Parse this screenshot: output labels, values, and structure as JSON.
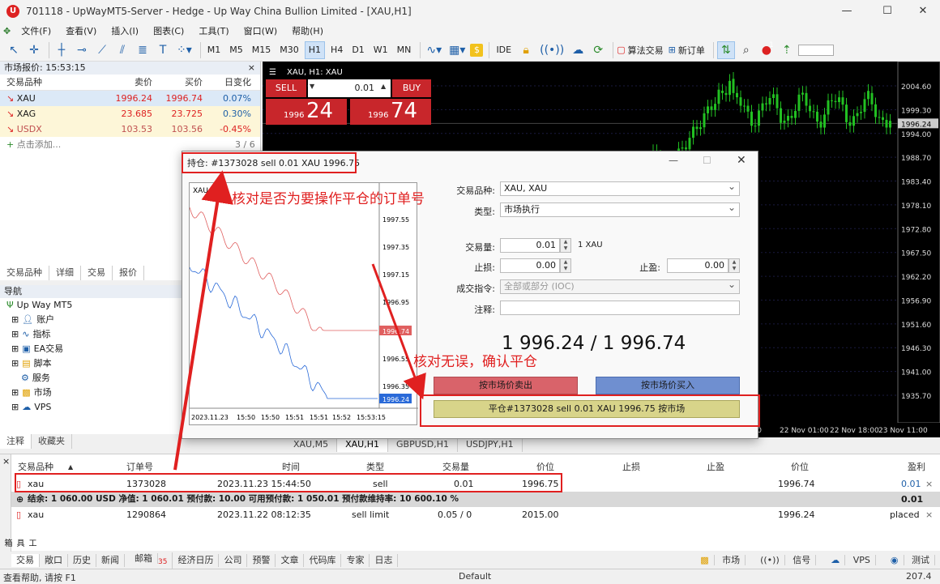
{
  "titlebar": {
    "logo": "U",
    "title": "701118 - UpWayMT5-Server - Hedge - Up Way China Bullion Limited - [XAU,H1]",
    "min": "—",
    "max": "☐",
    "close": "✕"
  },
  "menu": [
    "文件(F)",
    "查看(V)",
    "插入(I)",
    "图表(C)",
    "工具(T)",
    "窗口(W)",
    "帮助(H)"
  ],
  "toolbar": {
    "timeframes": [
      "M1",
      "M5",
      "M15",
      "M30",
      "H1",
      "H4",
      "D1",
      "W1",
      "MN"
    ],
    "active_tf": "H1",
    "ide": "IDE",
    "algo": "算法交易",
    "new_order": "新订单",
    "badge": "1"
  },
  "market_watch": {
    "title": "市场报价: 15:53:15",
    "headers": [
      "交易品种",
      "卖价",
      "买价",
      "日变化"
    ],
    "rows": [
      {
        "sym": "XAU",
        "bid": "1996.24",
        "ask": "1996.74",
        "chg": "0.07%"
      },
      {
        "sym": "XAG",
        "bid": "23.685",
        "ask": "23.725",
        "chg": "0.30%"
      },
      {
        "sym": "USDX",
        "bid": "103.53",
        "ask": "103.56",
        "chg": "-0.45%"
      }
    ],
    "add": "点击添加...",
    "count": "3 / 6",
    "tabs": [
      "交易品种",
      "详细",
      "交易",
      "报价"
    ]
  },
  "navigator": {
    "title": "导航",
    "root": "Up Way MT5",
    "items": [
      "账户",
      "指标",
      "EA交易",
      "脚本",
      "服务",
      "市场",
      "VPS"
    ],
    "tabs": [
      "注释",
      "收藏夹"
    ]
  },
  "chart": {
    "header": "XAU, H1: XAU",
    "sell": "SELL",
    "buy": "BUY",
    "lot": "0.01",
    "sell_big": "24",
    "sell_small": "1996",
    "buy_big": "74",
    "buy_small": "1996",
    "price_labels": [
      "2004.60",
      "1999.30",
      "1994.00",
      "1988.70",
      "1983.40",
      "1978.10",
      "1972.80",
      "1967.50",
      "1962.20",
      "1956.90",
      "1951.60",
      "1946.30",
      "1941.00",
      "1935.70"
    ],
    "current": "1996.24",
    "time_labels": [
      "09:00",
      "22 Nov 01:00",
      "22 Nov 18:00",
      "23 Nov 11:00"
    ],
    "tabs": [
      "XAU,M5",
      "XAU,H1",
      "GBPUSD,H1",
      "USDJPY,H1"
    ],
    "active_tab": "XAU,H1"
  },
  "dialog": {
    "title": "持仓: #1373028 sell 0.01 XAU 1996.75",
    "mini_symbol": "XAU",
    "mini_prices": [
      "1997.55",
      "1997.35",
      "1997.15",
      "1996.95",
      "1996.74",
      "1996.55",
      "1996.35",
      "1996.24"
    ],
    "mini_times": [
      "2023.11.23",
      "15:50",
      "15:50",
      "15:51",
      "15:51",
      "15:52",
      "15:53:15"
    ],
    "symbol_label": "交易品种:",
    "symbol": "XAU, XAU",
    "type_label": "类型:",
    "type": "市场执行",
    "volume_label": "交易量:",
    "volume": "0.01",
    "volume_unit": "1 XAU",
    "sl_label": "止损:",
    "sl": "0.00",
    "tp_label": "止盈:",
    "tp": "0.00",
    "fill_label": "成交指令:",
    "fill": "全部或部分 (IOC)",
    "comment_label": "注释:",
    "prices": "1 996.24 / 1 996.74",
    "sell_btn": "按市场价卖出",
    "buy_btn": "按市场价买入",
    "close_btn": "平仓#1373028 sell 0.01 XAU 1996.75 按市场"
  },
  "annotations": {
    "a1": "核对是否为要操作平仓的订单号",
    "a2": "核对无误，确认平仓"
  },
  "terminal": {
    "headers": [
      "交易品种",
      "订单号",
      "时间",
      "类型",
      "交易量",
      "价位",
      "止损",
      "止盈",
      "价位",
      "盈利"
    ],
    "position": {
      "sym": "xau",
      "ticket": "1373028",
      "time": "2023.11.23 15:44:50",
      "type": "sell",
      "vol": "0.01",
      "price": "1996.75",
      "cur": "1996.74",
      "profit": "0.01"
    },
    "balance": "结余: 1 060.00 USD  净值: 1 060.01  预付款: 10.00  可用预付款: 1 050.01  预付款维持率: 10 600.10 %",
    "balance_profit": "0.01",
    "order": {
      "sym": "xau",
      "ticket": "1290864",
      "time": "2023.11.22 08:12:35",
      "type": "sell limit",
      "vol": "0.05 / 0",
      "price": "2015.00",
      "cur": "1996.24",
      "status": "placed"
    },
    "tabs": [
      "交易",
      "敞口",
      "历史",
      "新闻",
      "邮箱",
      "经济日历",
      "公司",
      "预警",
      "文章",
      "代码库",
      "专家",
      "日志"
    ],
    "mail_badge": "35",
    "right": [
      "市场",
      "信号",
      "VPS",
      "测试"
    ],
    "vertical": "工具箱"
  },
  "status": {
    "help": "查看帮助, 请按 F1",
    "profile": "Default",
    "ping": "207.4"
  }
}
